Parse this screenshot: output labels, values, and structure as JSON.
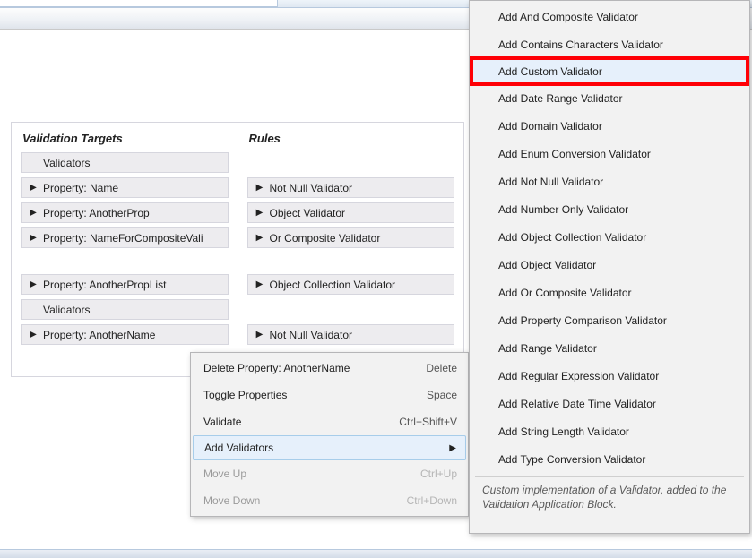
{
  "panels": {
    "validation_targets": {
      "title": "Validation Targets",
      "items": [
        {
          "label": "Validators",
          "chev": false
        },
        {
          "label": "Property: Name",
          "chev": true
        },
        {
          "label": "Property: AnotherProp",
          "chev": true
        },
        {
          "label": "Property: NameForCompositeVali",
          "chev": true
        },
        {
          "label": "Property: AnotherPropList",
          "chev": true
        },
        {
          "label": "Validators",
          "chev": false
        },
        {
          "label": "Property: AnotherName",
          "chev": true
        }
      ]
    },
    "rules": {
      "title": "Rules",
      "items": [
        {
          "label": "Not Null Validator",
          "chev": true
        },
        {
          "label": "Object Validator",
          "chev": true
        },
        {
          "label": "Or Composite Validator",
          "chev": true
        },
        {
          "label": "Object Collection Validator",
          "chev": true
        },
        {
          "label": "Not Null Validator",
          "chev": true
        }
      ]
    }
  },
  "context_menu": {
    "items": [
      {
        "label": "Delete Property: AnotherName",
        "accel": "Delete",
        "disabled": false
      },
      {
        "label": "Toggle Properties",
        "accel": "Space",
        "disabled": false
      },
      {
        "label": "Validate",
        "accel": "Ctrl+Shift+V",
        "disabled": false
      },
      {
        "label": "Add Validators",
        "accel": "",
        "submenu": true,
        "highlight": true,
        "disabled": false
      },
      {
        "label": "Move Up",
        "accel": "Ctrl+Up",
        "disabled": true
      },
      {
        "label": "Move Down",
        "accel": "Ctrl+Down",
        "disabled": true
      }
    ]
  },
  "submenu": {
    "items": [
      "Add And Composite Validator",
      "Add Contains Characters Validator",
      "Add Custom Validator",
      "Add Date Range Validator",
      "Add Domain Validator",
      "Add Enum Conversion Validator",
      "Add Not Null Validator",
      "Add Number Only Validator",
      "Add Object Collection Validator",
      "Add Object Validator",
      "Add Or Composite Validator",
      "Add Property Comparison Validator",
      "Add Range Validator",
      "Add Regular Expression Validator",
      "Add Relative Date Time Validator",
      "Add String Length Validator",
      "Add Type Conversion Validator"
    ],
    "highlight_index": 2,
    "tooltip": "Custom implementation of a Validator, added to the Validation Application Block."
  }
}
